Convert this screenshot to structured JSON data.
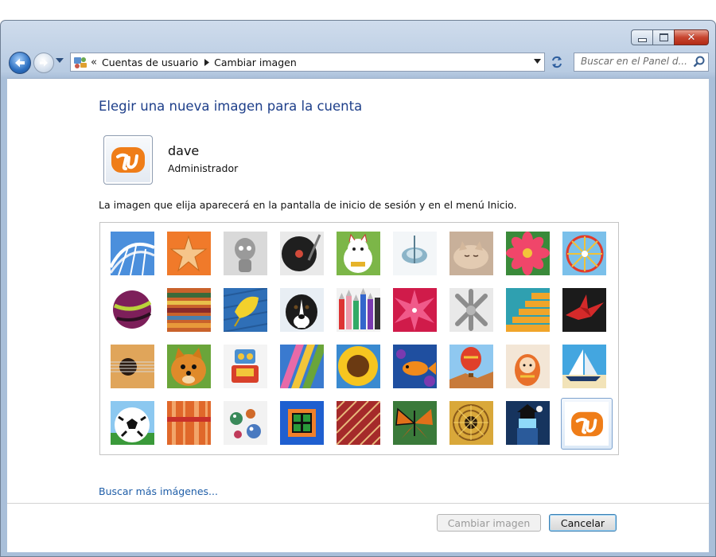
{
  "window": {
    "caption_buttons": [
      "minimize",
      "maximize",
      "close"
    ]
  },
  "navbar": {
    "breadcrumb": [
      "Cuentas de usuario",
      "Cambiar imagen"
    ],
    "overflow_chevron": "«",
    "search_placeholder": "Buscar en el Panel d..."
  },
  "main": {
    "title": "Elegir una nueva imagen para la cuenta",
    "user": {
      "name": "dave",
      "role": "Administrador"
    },
    "description": "La imagen que elija aparecerá en la pantalla de inicio de sesión y en el menú Inicio.",
    "pictures": [
      "roller-coaster",
      "starfish",
      "robot-figure",
      "turntable",
      "lucky-cat",
      "spinning-top",
      "kitten",
      "flower",
      "ferris-wheel",
      "ball",
      "fabric",
      "leaf",
      "dog",
      "crayons",
      "star",
      "jacks",
      "stairs",
      "paper-crane",
      "guitar",
      "puppy",
      "toy-robot",
      "scarves",
      "sunflower",
      "fish",
      "hot-air-balloon",
      "doll",
      "sailboat",
      "soccer-ball",
      "textile",
      "marbles",
      "window",
      "rug",
      "butterfly",
      "spiral",
      "lighthouse",
      "app-logo"
    ],
    "selected_picture": "app-logo",
    "more_link": "Buscar más imágenes...",
    "buttons": {
      "change": "Cambiar imagen",
      "cancel": "Cancelar"
    }
  },
  "colors": {
    "title_blue": "#1e3f8a",
    "link_blue": "#1f5ea8",
    "logo_orange": "#ef7d18"
  }
}
